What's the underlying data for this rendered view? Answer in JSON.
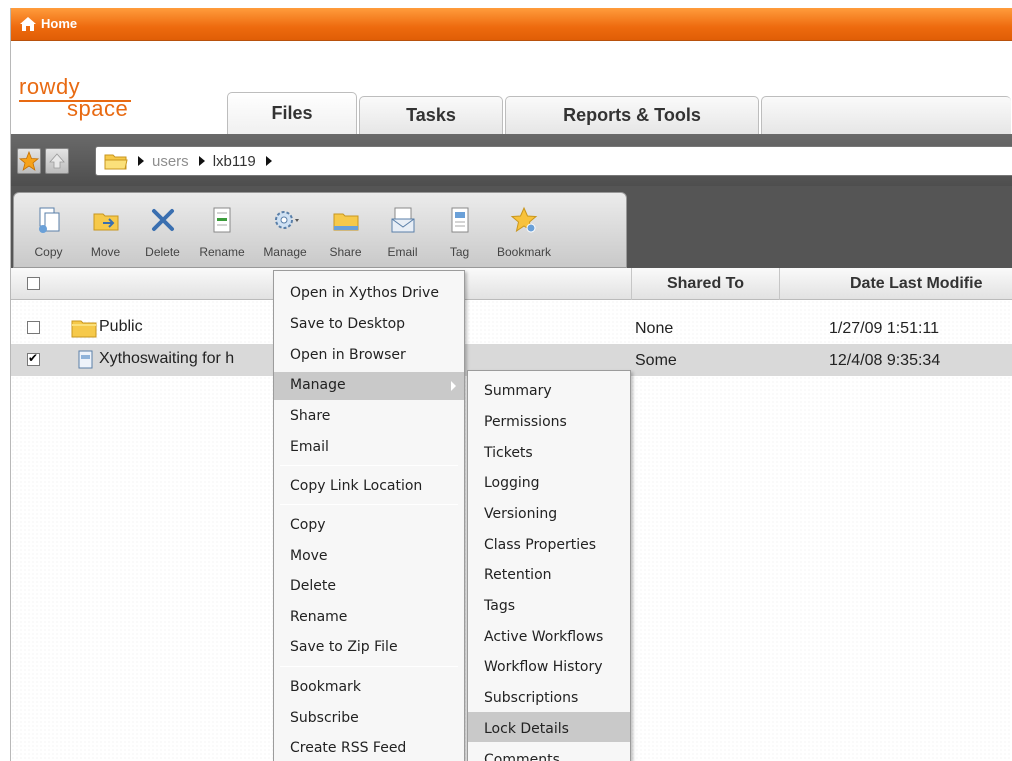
{
  "topbar": {
    "home_label": "Home",
    "home_icon": "home-icon"
  },
  "logo": {
    "line1": "rowdy",
    "line2": "space"
  },
  "tabs": [
    {
      "label": "Files",
      "active": true
    },
    {
      "label": "Tasks",
      "active": false
    },
    {
      "label": "Reports & Tools",
      "active": false
    }
  ],
  "breadcrumb": {
    "items": [
      "users",
      "lxb119"
    ]
  },
  "toolbar": {
    "copy": "Copy",
    "move": "Move",
    "delete": "Delete",
    "rename": "Rename",
    "manage": "Manage",
    "share": "Share",
    "email": "Email",
    "tag": "Tag",
    "bookmark": "Bookmark"
  },
  "table": {
    "headers": {
      "shared_to": "Shared To",
      "date_modified": "Date Last Modifie"
    },
    "rows": [
      {
        "name": "Public",
        "shared_to": "None",
        "date": "1/27/09 1:51:11",
        "checked": false
      },
      {
        "name": "Xythoswaiting for h",
        "shared_to": "Some",
        "date": "12/4/08 9:35:34",
        "checked": true
      }
    ]
  },
  "context_menu": {
    "items": [
      "Open in Xythos Drive",
      "Save to Desktop",
      "Open in Browser",
      "Manage",
      "Share",
      "Email",
      "Copy Link Location",
      "Copy",
      "Move",
      "Delete",
      "Rename",
      "Save to Zip File",
      "Bookmark",
      "Subscribe",
      "Create RSS Feed"
    ],
    "highlighted": "Manage"
  },
  "submenu": {
    "items": [
      "Summary",
      "Permissions",
      "Tickets",
      "Logging",
      "Versioning",
      "Class Properties",
      "Retention",
      "Tags",
      "Active Workflows",
      "Workflow History",
      "Subscriptions",
      "Lock Details",
      "Comments"
    ],
    "highlighted": "Lock Details"
  },
  "colors": {
    "accent": "#ee6a0e",
    "toolbar_bg": "#555555",
    "highlight": "#c9c9c9"
  }
}
